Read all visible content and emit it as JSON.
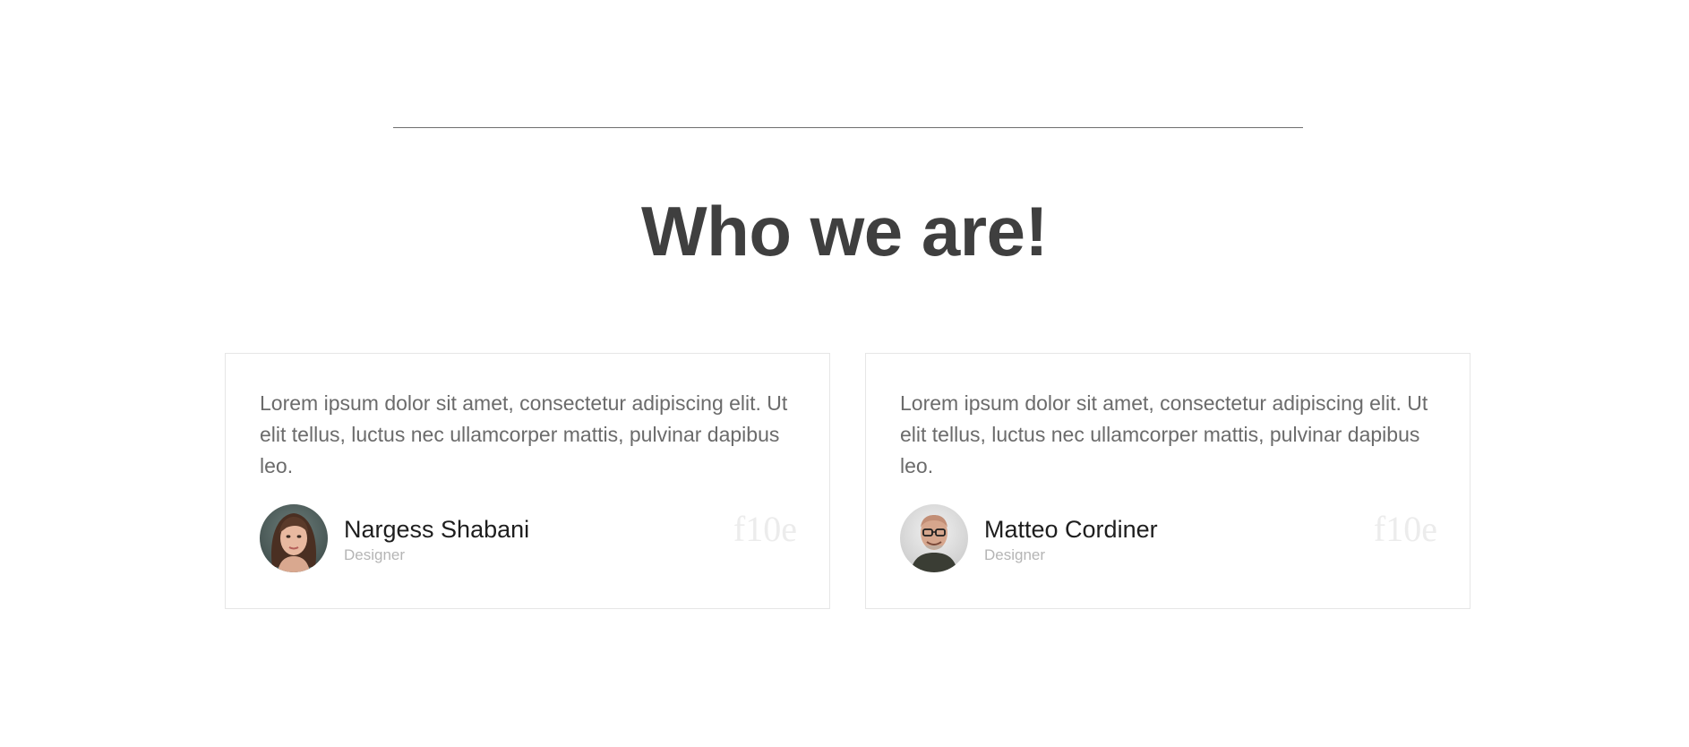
{
  "section": {
    "title": "Who we are!"
  },
  "testimonials": [
    {
      "quote": "Lorem ipsum dolor sit amet, consectetur adipiscing elit. Ut elit tellus, luctus nec ullamcorper mattis, pulvinar dapibus leo.",
      "name": "Nargess Shabani",
      "role": "Designer",
      "icon_text": "f10e",
      "icon": "quote-icon"
    },
    {
      "quote": "Lorem ipsum dolor sit amet, consectetur adipiscing elit. Ut elit tellus, luctus nec ullamcorper mattis, pulvinar dapibus leo.",
      "name": "Matteo Cordiner",
      "role": "Designer",
      "icon_text": "f10e",
      "icon": "quote-icon"
    }
  ],
  "colors": {
    "title": "#3f3f3f",
    "body_text": "#6b6b6b",
    "name": "#1e1e1e",
    "role": "#b5b5b5",
    "card_border": "#e6e6e6",
    "divider": "#6f6f6f"
  }
}
